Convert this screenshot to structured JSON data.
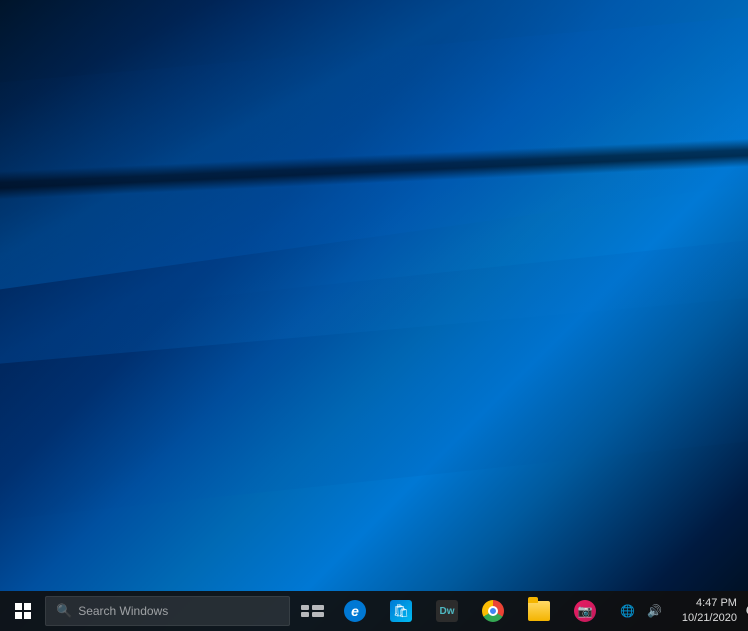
{
  "desktop": {
    "wallpaper_description": "Windows 10 default blue wallpaper with light beams"
  },
  "taskbar": {
    "start_label": "Start",
    "search_placeholder": "Search Windows",
    "apps": [
      {
        "id": "edge",
        "label": "Microsoft Edge",
        "icon": "edge-icon"
      },
      {
        "id": "store",
        "label": "Microsoft Store",
        "icon": "store-icon"
      },
      {
        "id": "dreamweaver",
        "label": "Adobe Dreamweaver",
        "icon": "dw-icon"
      },
      {
        "id": "chrome",
        "label": "Google Chrome",
        "icon": "chrome-icon"
      },
      {
        "id": "files",
        "label": "File Explorer",
        "icon": "files-icon"
      },
      {
        "id": "screenshot",
        "label": "Screenshot Tool",
        "icon": "camera-icon"
      }
    ],
    "tray": {
      "time": "4:47 PM",
      "date": "10/21/2020"
    },
    "notification_label": "Notifications"
  }
}
